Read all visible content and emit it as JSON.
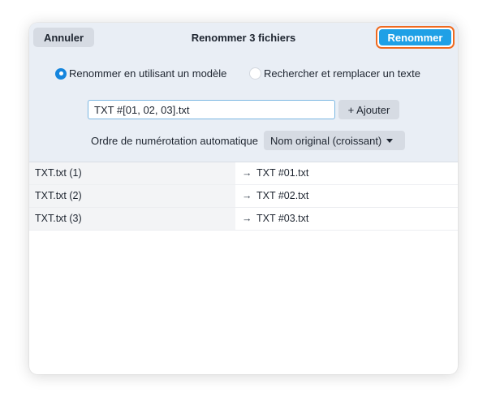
{
  "dialog": {
    "title": "Renommer 3 fichiers",
    "cancel_label": "Annuler",
    "rename_label": "Renommer"
  },
  "mode": {
    "options": [
      {
        "label": "Renommer en utilisant un modèle",
        "selected": true
      },
      {
        "label": "Rechercher et remplacer un texte",
        "selected": false
      }
    ]
  },
  "pattern": {
    "value": "TXT #[01, 02, 03].txt",
    "add_label": "+ Ajouter"
  },
  "numbering": {
    "label": "Ordre de numérotation automatique",
    "selected": "Nom original (croissant)"
  },
  "files": [
    {
      "original": "TXT.txt (1)",
      "arrow": "→",
      "renamed": "TXT #01.txt"
    },
    {
      "original": "TXT.txt (2)",
      "arrow": "→",
      "renamed": "TXT #02.txt"
    },
    {
      "original": "TXT.txt (3)",
      "arrow": "→",
      "renamed": "TXT #03.txt"
    }
  ],
  "colors": {
    "accent": "#1fa0e6",
    "focus_ring": "#ef6a1f",
    "panel_background": "#e9eef5"
  }
}
